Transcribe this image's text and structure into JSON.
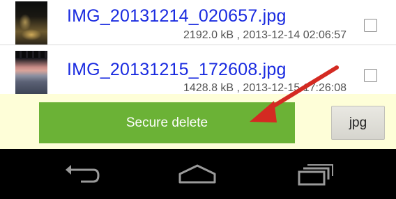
{
  "files": [
    {
      "name": "IMG_20131214_020657.jpg",
      "meta": "2192.0 kB , 2013-12-14 02:06:57",
      "checked": false
    },
    {
      "name": "IMG_20131215_172608.jpg",
      "meta": "1428.8 kB , 2013-12-15 17:26:08",
      "checked": false
    }
  ],
  "actions": {
    "secure_delete_label": "Secure delete",
    "extension_label": "jpg"
  },
  "nav": {
    "back_icon": "back-arrow-icon",
    "home_icon": "home-icon",
    "recent_icon": "recent-apps-icon"
  },
  "colors": {
    "file_name": "#1a2be0",
    "secure_delete": "#6bb236",
    "action_bar": "#fefed8",
    "annotation_arrow": "#d42a22"
  }
}
